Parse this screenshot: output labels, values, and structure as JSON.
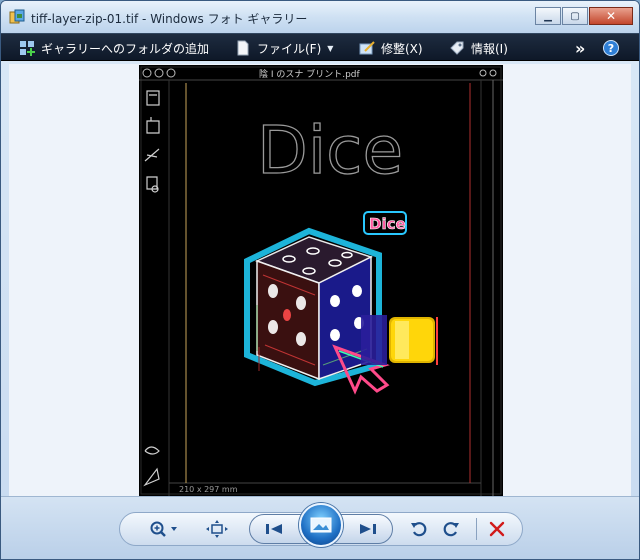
{
  "window": {
    "title": "tiff-layer-zip-01.tif - Windows フォト ギャラリー",
    "minimize_glyph": "▁",
    "maximize_glyph": "▢",
    "close_glyph": "✕"
  },
  "toolbar": {
    "add_folder_label": "ギャラリーへのフォルダの追加",
    "file_label": "ファイル(F)",
    "fix_label": "修整(X)",
    "info_label": "情報(I)",
    "more_glyph": "»",
    "help_glyph": "?"
  },
  "photo": {
    "big_title": "Dice",
    "small_title": "Dice",
    "header_text": "陰 Ⅰ のスナ ブリント.pdf",
    "size_text": "210 x 297 mm"
  },
  "colors": {
    "accent": "#1e6fc4",
    "delete_red": "#d11a1a",
    "toolbar_bg": "#0e1828"
  }
}
